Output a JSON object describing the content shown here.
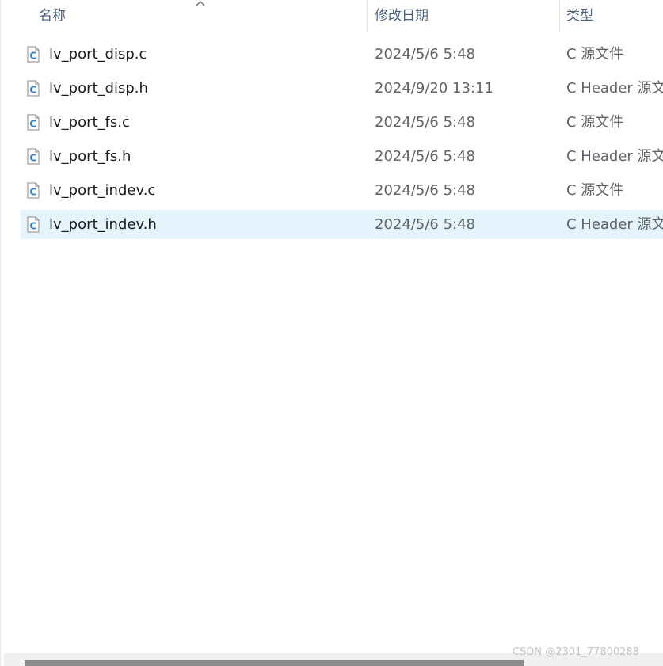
{
  "columns": {
    "name": "名称",
    "date": "修改日期",
    "type": "类型"
  },
  "files": [
    {
      "name": "lv_port_disp.c",
      "date": "2024/5/6 5:48",
      "type": "C 源文件",
      "icon": "c-source-file-icon",
      "selected": false
    },
    {
      "name": "lv_port_disp.h",
      "date": "2024/9/20 13:11",
      "type": "C Header 源文件",
      "icon": "c-header-file-icon",
      "selected": false
    },
    {
      "name": "lv_port_fs.c",
      "date": "2024/5/6 5:48",
      "type": "C 源文件",
      "icon": "c-source-file-icon",
      "selected": false
    },
    {
      "name": "lv_port_fs.h",
      "date": "2024/5/6 5:48",
      "type": "C Header 源文件",
      "icon": "c-header-file-icon",
      "selected": false
    },
    {
      "name": "lv_port_indev.c",
      "date": "2024/5/6 5:48",
      "type": "C 源文件",
      "icon": "c-source-file-icon",
      "selected": false
    },
    {
      "name": "lv_port_indev.h",
      "date": "2024/5/6 5:48",
      "type": "C Header 源文件",
      "icon": "c-header-file-icon",
      "selected": true
    }
  ],
  "watermark": "CSDN @2301_77800288",
  "colors": {
    "selection": "#e5f3fd",
    "header_text": "#4c607a",
    "icon_accent": "#3b7bbf"
  }
}
